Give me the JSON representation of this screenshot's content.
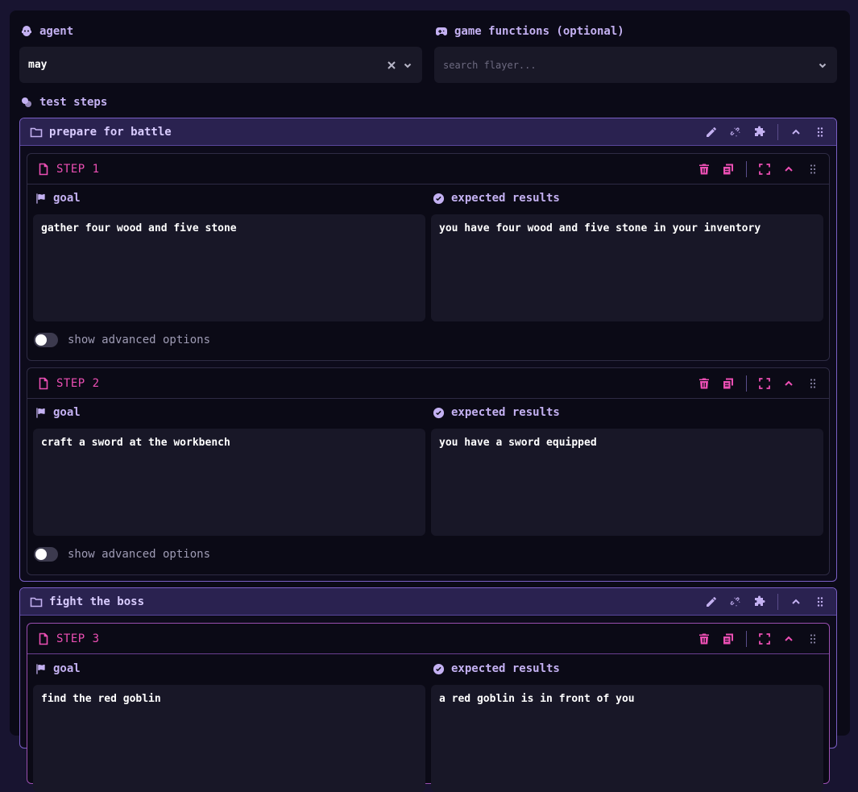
{
  "agent": {
    "label": "agent",
    "value": "may"
  },
  "game_functions": {
    "label": "game functions (optional)",
    "placeholder": "search flayer..."
  },
  "test_steps_label": "test steps",
  "groups": [
    {
      "title": "prepare for battle",
      "steps": [
        {
          "title": "STEP 1",
          "goal_label": "goal",
          "goal": "gather four wood and five stone",
          "expected_label": "expected results",
          "expected": "you have four wood and five stone in your inventory",
          "advanced_label": "show advanced options"
        },
        {
          "title": "STEP 2",
          "goal_label": "goal",
          "goal": "craft a sword at the workbench",
          "expected_label": "expected results",
          "expected": "you have a sword equipped",
          "advanced_label": "show advanced options"
        }
      ]
    },
    {
      "title": "fight the boss",
      "steps": [
        {
          "title": "STEP 3",
          "goal_label": "goal",
          "goal": "find the red goblin",
          "expected_label": "expected results",
          "expected": "a red goblin is in front of you"
        }
      ]
    }
  ]
}
